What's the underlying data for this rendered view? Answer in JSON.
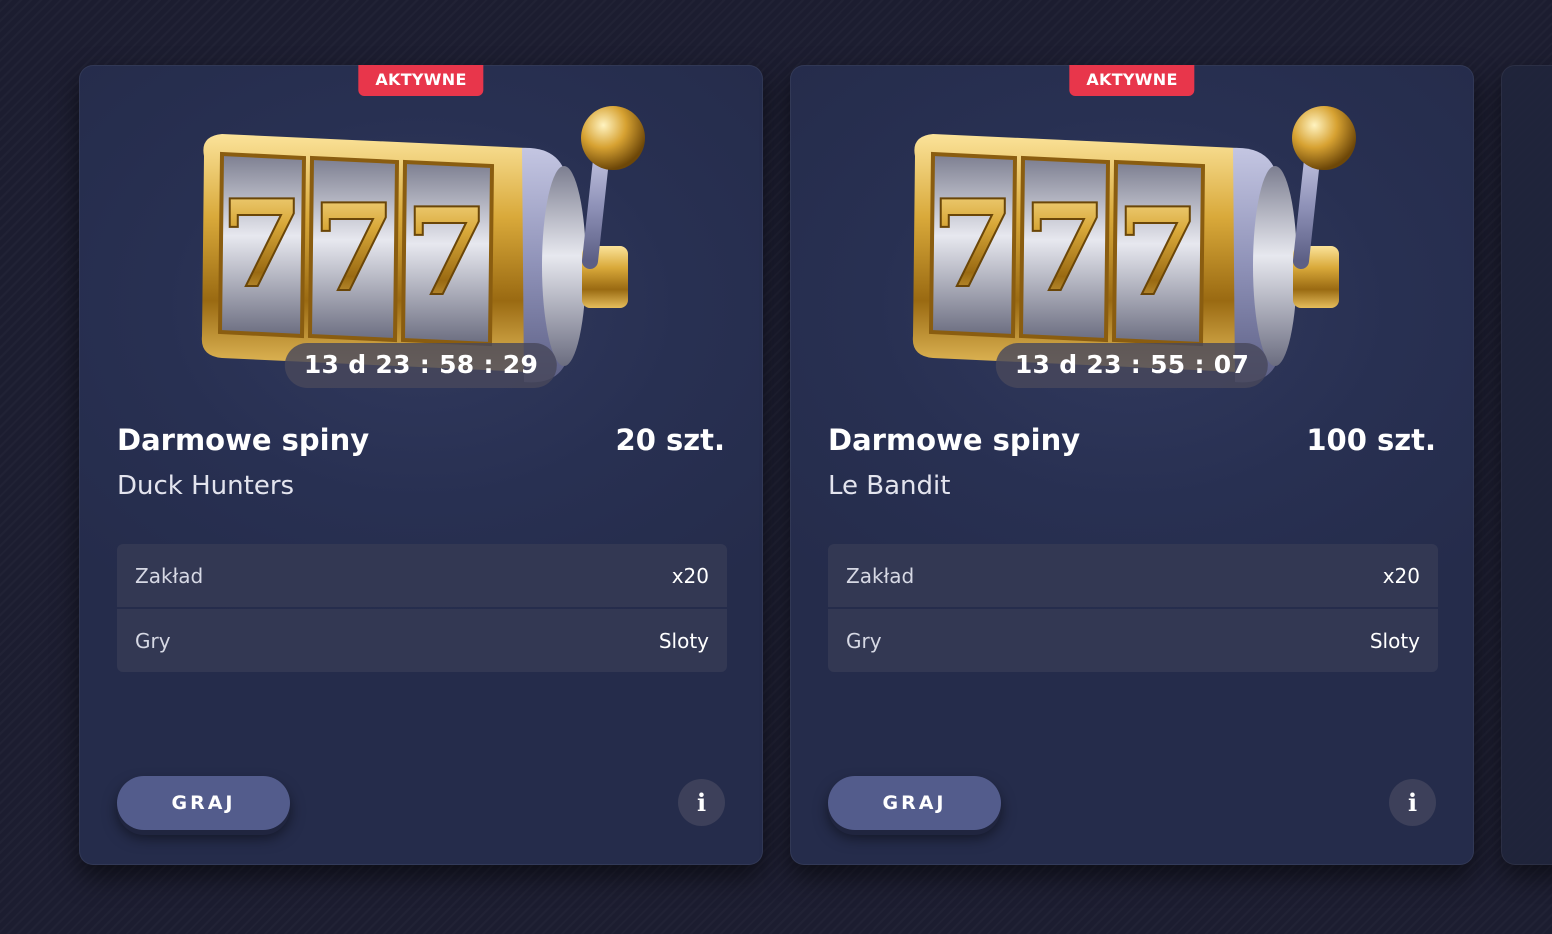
{
  "colors": {
    "page_background": "#1c1d30",
    "card_background": "#283052",
    "badge_red": "#e8364b",
    "play_button": "#535c8c",
    "table_row": "#333853"
  },
  "cards": [
    {
      "badge": "AKTYWNE",
      "timer": "13 d 23 : 58 : 29",
      "title": "Darmowe spiny",
      "amount": "20 szt.",
      "game": "Duck Hunters",
      "rows": [
        {
          "label": "Zakład",
          "value": "x20"
        },
        {
          "label": "Gry",
          "value": "Sloty"
        }
      ],
      "play_label": "GRAJ",
      "info_icon": "i"
    },
    {
      "badge": "AKTYWNE",
      "timer": "13 d 23 : 55 : 07",
      "title": "Darmowe spiny",
      "amount": "100 szt.",
      "game": "Le Bandit",
      "rows": [
        {
          "label": "Zakład",
          "value": "x20"
        },
        {
          "label": "Gry",
          "value": "Sloty"
        }
      ],
      "play_label": "GRAJ",
      "info_icon": "i"
    }
  ],
  "icons": {
    "machine": "slot-machine-777-icon",
    "info": "info-icon"
  }
}
